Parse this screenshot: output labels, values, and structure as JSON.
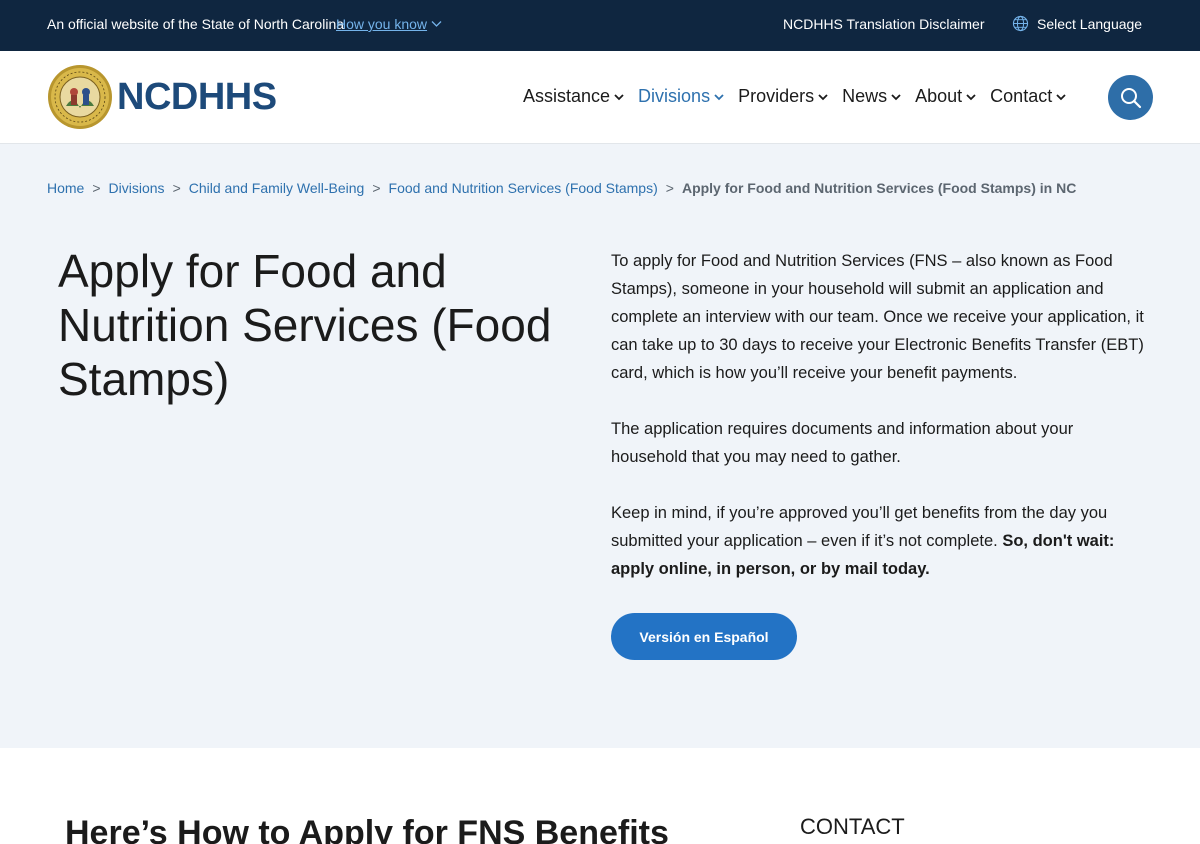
{
  "top_bar": {
    "official_text": "An official website of the State of North Carolina",
    "how_you_know": "How you know",
    "translation_disclaimer": "NCDHHS Translation Disclaimer",
    "select_language": "Select Language",
    "background_color": "#0f2640"
  },
  "header": {
    "logo_text": "NCDHHS",
    "nav": [
      {
        "label": "Assistance",
        "active": false
      },
      {
        "label": "Divisions",
        "active": true
      },
      {
        "label": "Providers",
        "active": false
      },
      {
        "label": "News",
        "active": false
      },
      {
        "label": "About",
        "active": false
      },
      {
        "label": "Contact",
        "active": false
      }
    ],
    "search_icon": "search-icon",
    "accent_color": "#2e71ae"
  },
  "breadcrumb": {
    "items": [
      "Home",
      "Divisions",
      "Child and Family Well-Being",
      "Food and Nutrition Services (Food Stamps)"
    ],
    "separator": ">",
    "current": "Apply for Food and Nutrition Services (Food Stamps) in NC"
  },
  "hero": {
    "title": "Apply for Food and Nutrition Services (Food Stamps)",
    "paragraph1": "To apply for Food and Nutrition Services (FNS – also known as Food Stamps), someone in your household will submit an application and complete an interview with our team. Once we receive your application, it can take up to 30 days to receive your Electronic Benefits Transfer (EBT) card, which is how you’ll receive your benefit payments.",
    "paragraph2": "The application requires documents and information about your household that you may need to gather.",
    "paragraph3_plain": "Keep in mind, if you’re approved you’ll get benefits from the day you submitted your application – even if it’s not complete. ",
    "paragraph3_bold": "So, don't wait: apply online, in person, or by mail today.",
    "spanish_button": "Versión en Español",
    "background_color": "#f0f4f9",
    "button_color": "#2373c5"
  },
  "section": {
    "title": "Here’s How to Apply for FNS Benefits",
    "contact_label": "CONTACT"
  }
}
